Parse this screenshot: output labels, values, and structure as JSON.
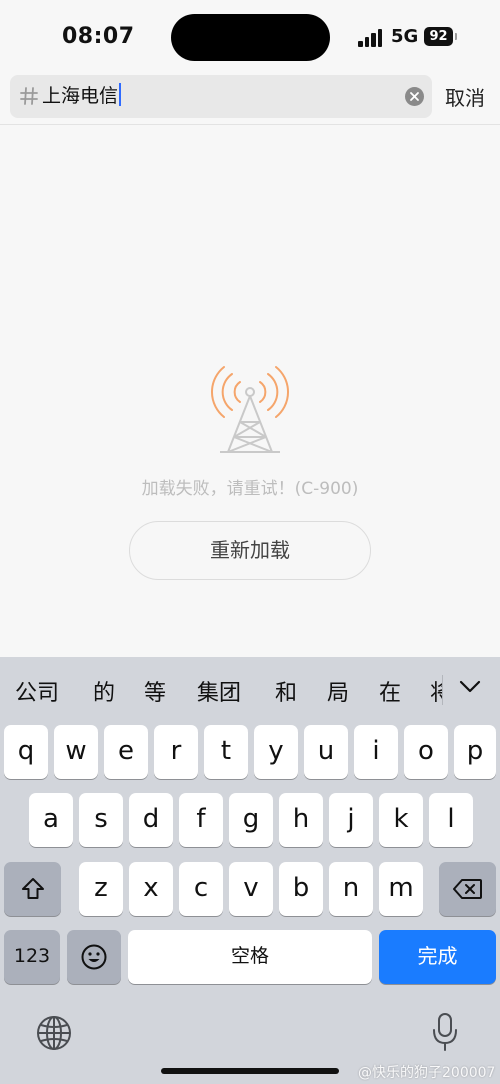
{
  "status_bar": {
    "time": "08:07",
    "network": "5G",
    "battery": "92"
  },
  "search": {
    "prefix_icon": "hash-icon",
    "value": "上海电信",
    "cancel_label": "取消"
  },
  "error": {
    "message": "加载失败，请重试！(C-900)",
    "retry_label": "重新加载",
    "icon": "signal-tower-icon",
    "accent_color": "#f5a56b"
  },
  "keyboard": {
    "suggestions": [
      "公司",
      "的",
      "等",
      "集团",
      "和",
      "局",
      "在",
      "将"
    ],
    "row1": [
      "q",
      "w",
      "e",
      "r",
      "t",
      "y",
      "u",
      "i",
      "o",
      "p"
    ],
    "row2": [
      "a",
      "s",
      "d",
      "f",
      "g",
      "h",
      "j",
      "k",
      "l"
    ],
    "row3": [
      "z",
      "x",
      "c",
      "v",
      "b",
      "n",
      "m"
    ],
    "numbers_label": "123",
    "space_label": "空格",
    "done_label": "完成",
    "done_color": "#1a7cff"
  },
  "watermark": "@快乐的狗子200007"
}
